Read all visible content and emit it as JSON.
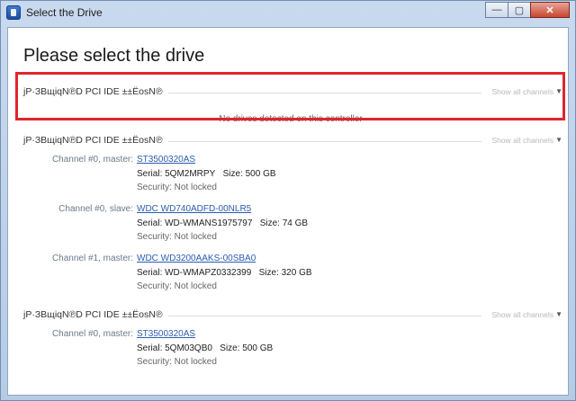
{
  "window": {
    "title": "Select the Drive",
    "buttons": {
      "minimize": "—",
      "maximize": "▢",
      "close": "✕"
    }
  },
  "heading": "Please select the drive",
  "controllers": [
    {
      "name": "јР·ЗВщiqN℗D PCI IDE ±±ЁosN℗",
      "show_all": "Show all channels",
      "empty_message": "No drives detected on this controller",
      "drives": []
    },
    {
      "name": "јР·ЗВщiqN℗D PCI IDE ±±ЁosN℗",
      "show_all": "Show all channels",
      "drives": [
        {
          "channel": "Channel #0, master:",
          "model": "ST3500320AS",
          "serial": "Serial: 5QM2MRPY",
          "size": "Size: 500 GB",
          "security": "Security: Not locked"
        },
        {
          "channel": "Channel #0, slave:",
          "model": "WDC WD740ADFD-00NLR5",
          "serial": "Serial: WD-WMANS1975797",
          "size": "Size: 74 GB",
          "security": "Security: Not locked"
        },
        {
          "channel": "Channel #1, master:",
          "model": "WDC WD3200AAKS-00SBA0",
          "serial": "Serial: WD-WMAPZ0332399",
          "size": "Size: 320 GB",
          "security": "Security: Not locked"
        }
      ]
    },
    {
      "name": "јР·ЗВщiqN℗D PCI IDE ±±ЁosN℗",
      "show_all": "Show all channels",
      "drives": [
        {
          "channel": "Channel #0, master:",
          "model": "ST3500320AS",
          "serial": "Serial: 5QM03QB0",
          "size": "Size: 500 GB",
          "security": "Security: Not locked"
        }
      ]
    }
  ],
  "colors": {
    "highlight": "#e0262c",
    "link": "#2a5db0"
  }
}
